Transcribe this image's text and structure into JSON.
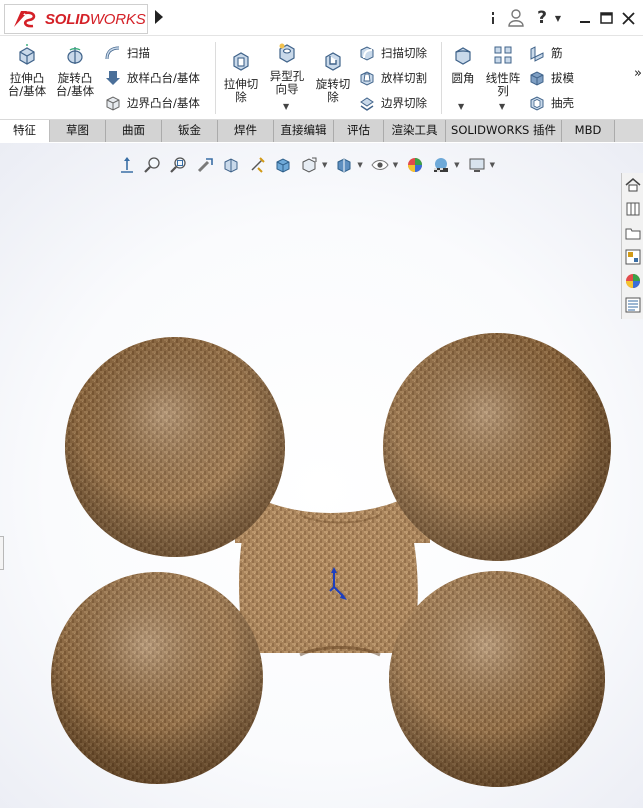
{
  "app": {
    "logo_text_bold": "SOLID",
    "logo_text_light": "WORKS",
    "brand_color": "#d42027"
  },
  "titlebar_icons": [
    "expand-pin-icon",
    "user-icon",
    "help-icon",
    "dropdown-icon",
    "minimize-icon",
    "maximize-icon",
    "close-icon"
  ],
  "ribbon": {
    "extrude_boss": "拉伸凸\n台/基体",
    "revolve_boss": "旋转凸\n台/基体",
    "sweep": "扫描",
    "loft_boss": "放样凸台/基体",
    "boundary_boss": "边界凸台/基体",
    "extrude_cut": "拉伸切\n除",
    "hole_wizard": "异型孔\n向导",
    "revolve_cut": "旋转切\n除",
    "swept_cut": "扫描切除",
    "lofted_cut": "放样切割",
    "boundary_cut": "边界切除",
    "fillet": "圆角",
    "linear_pattern": "线性阵\n列",
    "rib": "筋",
    "draft": "拔模",
    "shell": "抽壳",
    "overflow": "»"
  },
  "tabs": [
    {
      "label": "特征",
      "active": true
    },
    {
      "label": "草图",
      "active": false
    },
    {
      "label": "曲面",
      "active": false
    },
    {
      "label": "钣金",
      "active": false
    },
    {
      "label": "焊件",
      "active": false
    },
    {
      "label": "直接编辑",
      "active": false
    },
    {
      "label": "评估",
      "active": false
    },
    {
      "label": "渲染工具",
      "active": false
    },
    {
      "label": "SOLIDWORKS 插件",
      "active": false
    },
    {
      "label": "MBD",
      "active": false
    }
  ],
  "heads_up_toolbar": [
    "view-orientation-icon",
    "zoom-to-fit-icon",
    "zoom-area-icon",
    "previous-view-icon",
    "section-view-icon",
    "dynamic-annotation-icon",
    "view-orientation-cube-icon",
    "display-style-icon",
    "hide-show-icon",
    "edit-appearance-icon",
    "apply-scene-icon",
    "view-settings-icon"
  ],
  "task_pane": [
    "home-icon",
    "design-library-icon",
    "file-explorer-icon",
    "view-palette-icon",
    "appearances-icon",
    "custom-properties-icon"
  ],
  "model": {
    "description_colors": {
      "texture_base": "#a57a4c",
      "texture_dark": "#6b4726",
      "texture_light": "#c9a070"
    }
  }
}
